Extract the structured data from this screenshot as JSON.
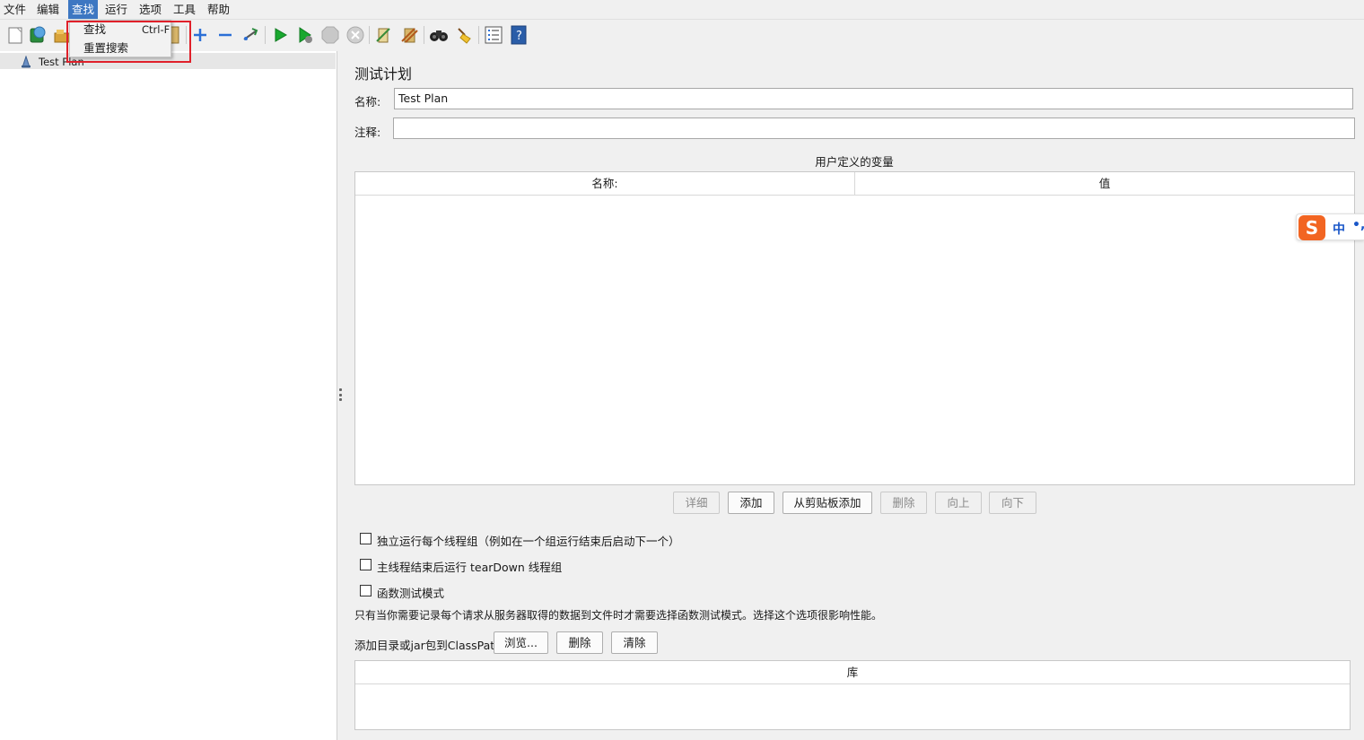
{
  "menubar": {
    "items": [
      "文件",
      "编辑",
      "查找",
      "运行",
      "选项",
      "工具",
      "帮助"
    ],
    "active_index": 2
  },
  "dropdown": {
    "items": [
      {
        "label": "查找",
        "shortcut": "Ctrl-F"
      },
      {
        "label": "重置搜索",
        "shortcut": ""
      }
    ]
  },
  "toolbar": {
    "icons": [
      "new-icon",
      "templates-icon",
      "open-icon",
      "save-icon",
      "expand-icon",
      "collapse-icon",
      "toggle-icon",
      "start-icon",
      "start-no-pauses-icon",
      "stop-icon",
      "shutdown-icon",
      "clear-icon",
      "clear-all-icon",
      "search-icon",
      "reset-search-icon",
      "function-helper-icon",
      "help-icon"
    ]
  },
  "tree": {
    "root_label": "Test Plan"
  },
  "panel": {
    "title": "测试计划",
    "name_label": "名称:",
    "name_value": "Test Plan",
    "comment_label": "注释:",
    "comment_value": "",
    "vars_title": "用户定义的变量",
    "vars_columns": [
      "名称:",
      "值"
    ],
    "vars_buttons": [
      {
        "label": "详细",
        "enabled": false
      },
      {
        "label": "添加",
        "enabled": true
      },
      {
        "label": "从剪贴板添加",
        "enabled": true
      },
      {
        "label": "删除",
        "enabled": false
      },
      {
        "label": "向上",
        "enabled": false
      },
      {
        "label": "向下",
        "enabled": false
      }
    ],
    "checkboxes": [
      {
        "label": "独立运行每个线程组（例如在一个组运行结束后启动下一个）",
        "checked": false
      },
      {
        "label": "主线程结束后运行 tearDown 线程组",
        "checked": false
      },
      {
        "label": "函数测试模式",
        "checked": false
      }
    ],
    "functional_note": "只有当你需要记录每个请求从服务器取得的数据到文件时才需要选择函数测试模式。选择这个选项很影响性能。",
    "classpath_label": "添加目录或jar包到ClassPath",
    "classpath_buttons": [
      "浏览...",
      "删除",
      "清除"
    ],
    "library_column": "库"
  },
  "ime": {
    "logo": "S",
    "mode": "中",
    "punct": "•,"
  },
  "colors": {
    "menu_active": "#3d77c2",
    "highlight": "#e0202a",
    "ime_orange": "#f26522"
  }
}
